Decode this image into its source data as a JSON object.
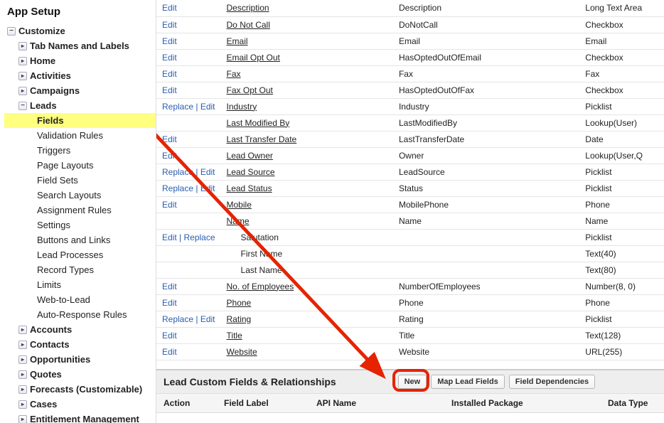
{
  "sidebar": {
    "title": "App Setup",
    "items": [
      {
        "level": 0,
        "label": "Customize",
        "toggle": "open"
      },
      {
        "level": 1,
        "label": "Tab Names and Labels",
        "toggle": "closed"
      },
      {
        "level": 1,
        "label": "Home",
        "toggle": "closed"
      },
      {
        "level": 1,
        "label": "Activities",
        "toggle": "closed"
      },
      {
        "level": 1,
        "label": "Campaigns",
        "toggle": "closed"
      },
      {
        "level": 1,
        "label": "Leads",
        "toggle": "open"
      },
      {
        "level": 2,
        "label": "Fields",
        "selected": true,
        "bold": true
      },
      {
        "level": 2,
        "label": "Validation Rules"
      },
      {
        "level": 2,
        "label": "Triggers"
      },
      {
        "level": 2,
        "label": "Page Layouts"
      },
      {
        "level": 2,
        "label": "Field Sets"
      },
      {
        "level": 2,
        "label": "Search Layouts"
      },
      {
        "level": 2,
        "label": "Assignment Rules"
      },
      {
        "level": 2,
        "label": "Settings"
      },
      {
        "level": 2,
        "label": "Buttons and Links"
      },
      {
        "level": 2,
        "label": "Lead Processes"
      },
      {
        "level": 2,
        "label": "Record Types"
      },
      {
        "level": 2,
        "label": "Limits"
      },
      {
        "level": 2,
        "label": "Web-to-Lead"
      },
      {
        "level": 2,
        "label": "Auto-Response Rules"
      },
      {
        "level": 1,
        "label": "Accounts",
        "toggle": "closed"
      },
      {
        "level": 1,
        "label": "Contacts",
        "toggle": "closed"
      },
      {
        "level": 1,
        "label": "Opportunities",
        "toggle": "closed"
      },
      {
        "level": 1,
        "label": "Quotes",
        "toggle": "closed"
      },
      {
        "level": 1,
        "label": "Forecasts (Customizable)",
        "toggle": "closed"
      },
      {
        "level": 1,
        "label": "Cases",
        "toggle": "closed"
      },
      {
        "level": 1,
        "label": "Entitlement Management",
        "toggle": "closed"
      }
    ]
  },
  "fields": [
    {
      "actions": [
        "Edit"
      ],
      "label": "Description",
      "api": "Description",
      "type": "Long Text Area",
      "underline": true
    },
    {
      "actions": [
        "Edit"
      ],
      "label": "Do Not Call",
      "api": "DoNotCall",
      "type": "Checkbox",
      "underline": true
    },
    {
      "actions": [
        "Edit"
      ],
      "label": "Email",
      "api": "Email",
      "type": "Email",
      "underline": true
    },
    {
      "actions": [
        "Edit"
      ],
      "label": "Email Opt Out",
      "api": "HasOptedOutOfEmail",
      "type": "Checkbox",
      "underline": true
    },
    {
      "actions": [
        "Edit"
      ],
      "label": "Fax",
      "api": "Fax",
      "type": "Fax",
      "underline": true
    },
    {
      "actions": [
        "Edit"
      ],
      "label": "Fax Opt Out",
      "api": "HasOptedOutOfFax",
      "type": "Checkbox",
      "underline": true
    },
    {
      "actions": [
        "Replace",
        "Edit"
      ],
      "label": "Industry",
      "api": "Industry",
      "type": "Picklist",
      "underline": true
    },
    {
      "actions": [],
      "label": "Last Modified By",
      "api": "LastModifiedBy",
      "type": "Lookup(User)",
      "underline": true
    },
    {
      "actions": [
        "Edit"
      ],
      "label": "Last Transfer Date",
      "api": "LastTransferDate",
      "type": "Date",
      "underline": true
    },
    {
      "actions": [
        "Edit"
      ],
      "label": "Lead Owner",
      "api": "Owner",
      "type": "Lookup(User,Q",
      "underline": true
    },
    {
      "actions": [
        "Replace",
        "Edit"
      ],
      "label": "Lead Source",
      "api": "LeadSource",
      "type": "Picklist",
      "underline": true
    },
    {
      "actions": [
        "Replace",
        "Edit"
      ],
      "label": "Lead Status",
      "api": "Status",
      "type": "Picklist",
      "underline": true
    },
    {
      "actions": [
        "Edit"
      ],
      "label": "Mobile",
      "api": "MobilePhone",
      "type": "Phone",
      "underline": true
    },
    {
      "actions": [],
      "label": "Name",
      "api": "Name",
      "type": "Name",
      "underline": true
    },
    {
      "actions": [
        "Edit",
        "Replace"
      ],
      "label": "Salutation",
      "api": "",
      "type": "Picklist",
      "indent": 1
    },
    {
      "actions": [],
      "label": "First Name",
      "api": "",
      "type": "Text(40)",
      "indent": 1
    },
    {
      "actions": [],
      "label": "Last Name",
      "api": "",
      "type": "Text(80)",
      "indent": 1
    },
    {
      "actions": [
        "Edit"
      ],
      "label": "No. of Employees",
      "api": "NumberOfEmployees",
      "type": "Number(8, 0)",
      "underline": true
    },
    {
      "actions": [
        "Edit"
      ],
      "label": "Phone",
      "api": "Phone",
      "type": "Phone",
      "underline": true
    },
    {
      "actions": [
        "Replace",
        "Edit"
      ],
      "label": "Rating",
      "api": "Rating",
      "type": "Picklist",
      "underline": true
    },
    {
      "actions": [
        "Edit"
      ],
      "label": "Title",
      "api": "Title",
      "type": "Text(128)",
      "underline": true
    },
    {
      "actions": [
        "Edit"
      ],
      "label": "Website",
      "api": "Website",
      "type": "URL(255)",
      "underline": true
    }
  ],
  "custom_section": {
    "title": "Lead Custom Fields & Relationships",
    "buttons": {
      "new": "New",
      "map": "Map Lead Fields",
      "deps": "Field Dependencies"
    },
    "columns": {
      "action": "Action",
      "label": "Field Label",
      "api": "API Name",
      "pkg": "Installed Package",
      "type": "Data Type"
    }
  }
}
